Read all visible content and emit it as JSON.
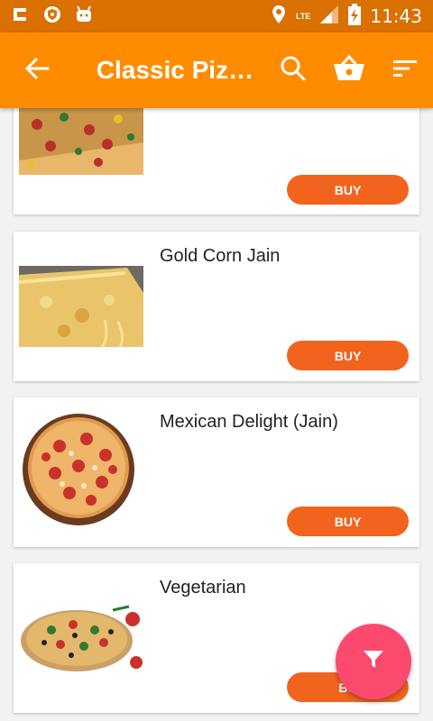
{
  "status_bar": {
    "time": "11:43",
    "network_label": "LTE",
    "icons": [
      "c-app-icon",
      "shield-icon",
      "android-icon",
      "location-icon",
      "signal-icon",
      "battery-charging-icon"
    ]
  },
  "app_bar": {
    "title": "Classic Piz…",
    "back_icon": "arrow-back-icon",
    "actions": [
      "search-icon",
      "basket-icon",
      "sort-icon"
    ],
    "color": "#ff8c00"
  },
  "products": [
    {
      "name": "",
      "buy_label": "BUY",
      "image": "pizza-slice-veg"
    },
    {
      "name": "Gold Corn Jain",
      "buy_label": "BUY",
      "image": "cheese-pizza-slice"
    },
    {
      "name": "Mexican Delight (Jain)",
      "buy_label": "BUY",
      "image": "whole-pizza-tomato"
    },
    {
      "name": "Vegetarian",
      "buy_label": "BU",
      "image": "vegetarian-pizza"
    }
  ],
  "fab": {
    "icon": "filter-icon",
    "color": "#fb4a6e"
  },
  "colors": {
    "status_bar": "#d97000",
    "buy_button": "#f2631e",
    "background": "#f2f2f2"
  }
}
